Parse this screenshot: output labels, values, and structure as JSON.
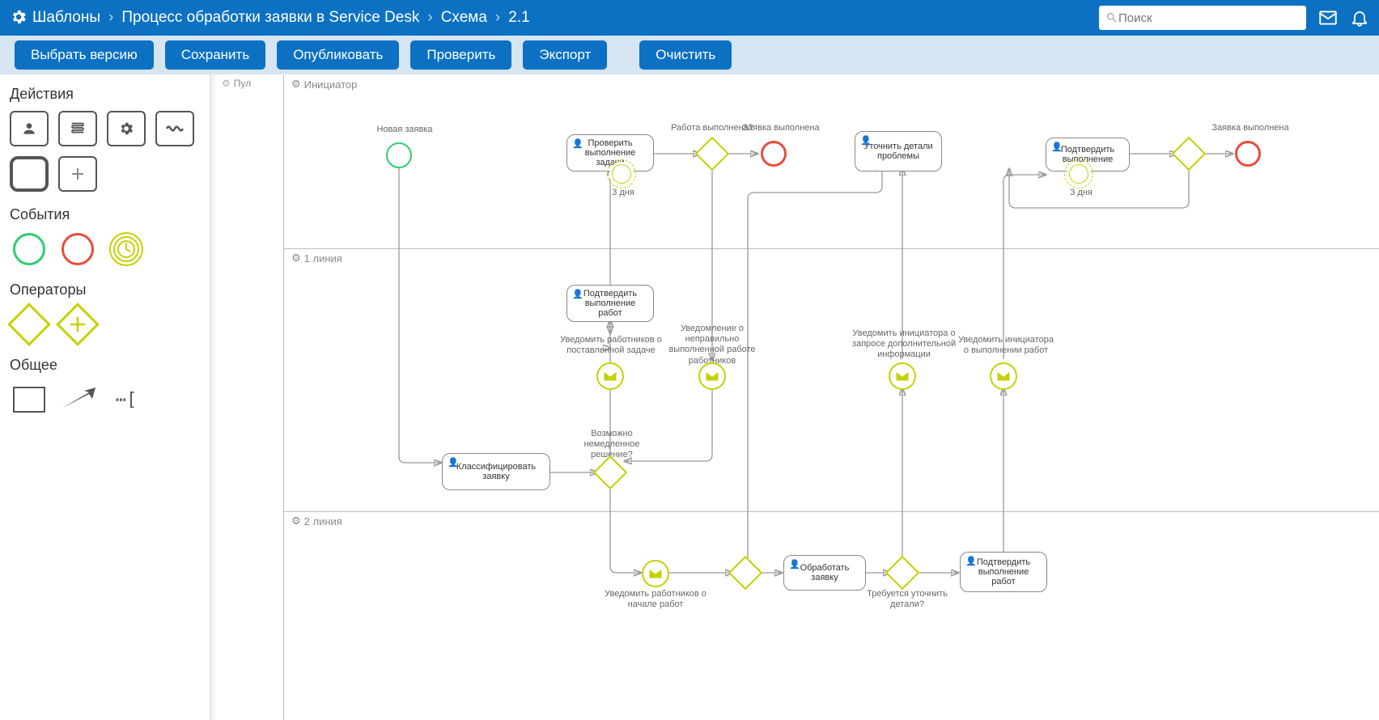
{
  "header": {
    "breadcrumb": [
      "Шаблоны",
      "Процесс обработки заявки в Service Desk",
      "Схема",
      "2.1"
    ],
    "search_placeholder": "Поиск"
  },
  "toolbar": {
    "select_version": "Выбрать версию",
    "save": "Сохранить",
    "publish": "Опубликовать",
    "check": "Проверить",
    "export": "Экспорт",
    "clear": "Очистить"
  },
  "sidebar": {
    "actions_title": "Действия",
    "events_title": "События",
    "operators_title": "Операторы",
    "general_title": "Общее"
  },
  "pool": {
    "label": "Пул"
  },
  "lanes": {
    "initiator": "Инициатор",
    "line1": "1 линия",
    "line2": "2 линия"
  },
  "nodes": {
    "new_request": "Новая заявка",
    "check_task": "Проверить выполнение задачи",
    "work_done_q": "Работа выполнена?",
    "request_done_1": "Заявка выполнена",
    "clarify_details": "Уточнить детали проблемы",
    "confirm_exec": "Подтвердить выполнение",
    "request_done_2": "Заявка выполнена",
    "three_days_1": "3 дня",
    "three_days_2": "3 дня",
    "classify": "Классифицировать заявку",
    "immediate_q": "Возможно немедленное решение?",
    "confirm_works": "Подтвердить выполнение работ",
    "notify_task": "Уведомить работников о поставленной задаче",
    "notify_wrong": "Уведомление о неправильно выполненной работе работников",
    "notify_extra": "Уведомить инициатора о запросе дополнительной информации",
    "notify_done": "Уведомить инициатора о выполнении работ",
    "notify_start": "Уведомить работников о начале работ",
    "process_req": "Обработать заявку",
    "need_clarify_q": "Требуется уточнить детали?",
    "confirm_works_2": "Подтвердить выполнение работ"
  }
}
